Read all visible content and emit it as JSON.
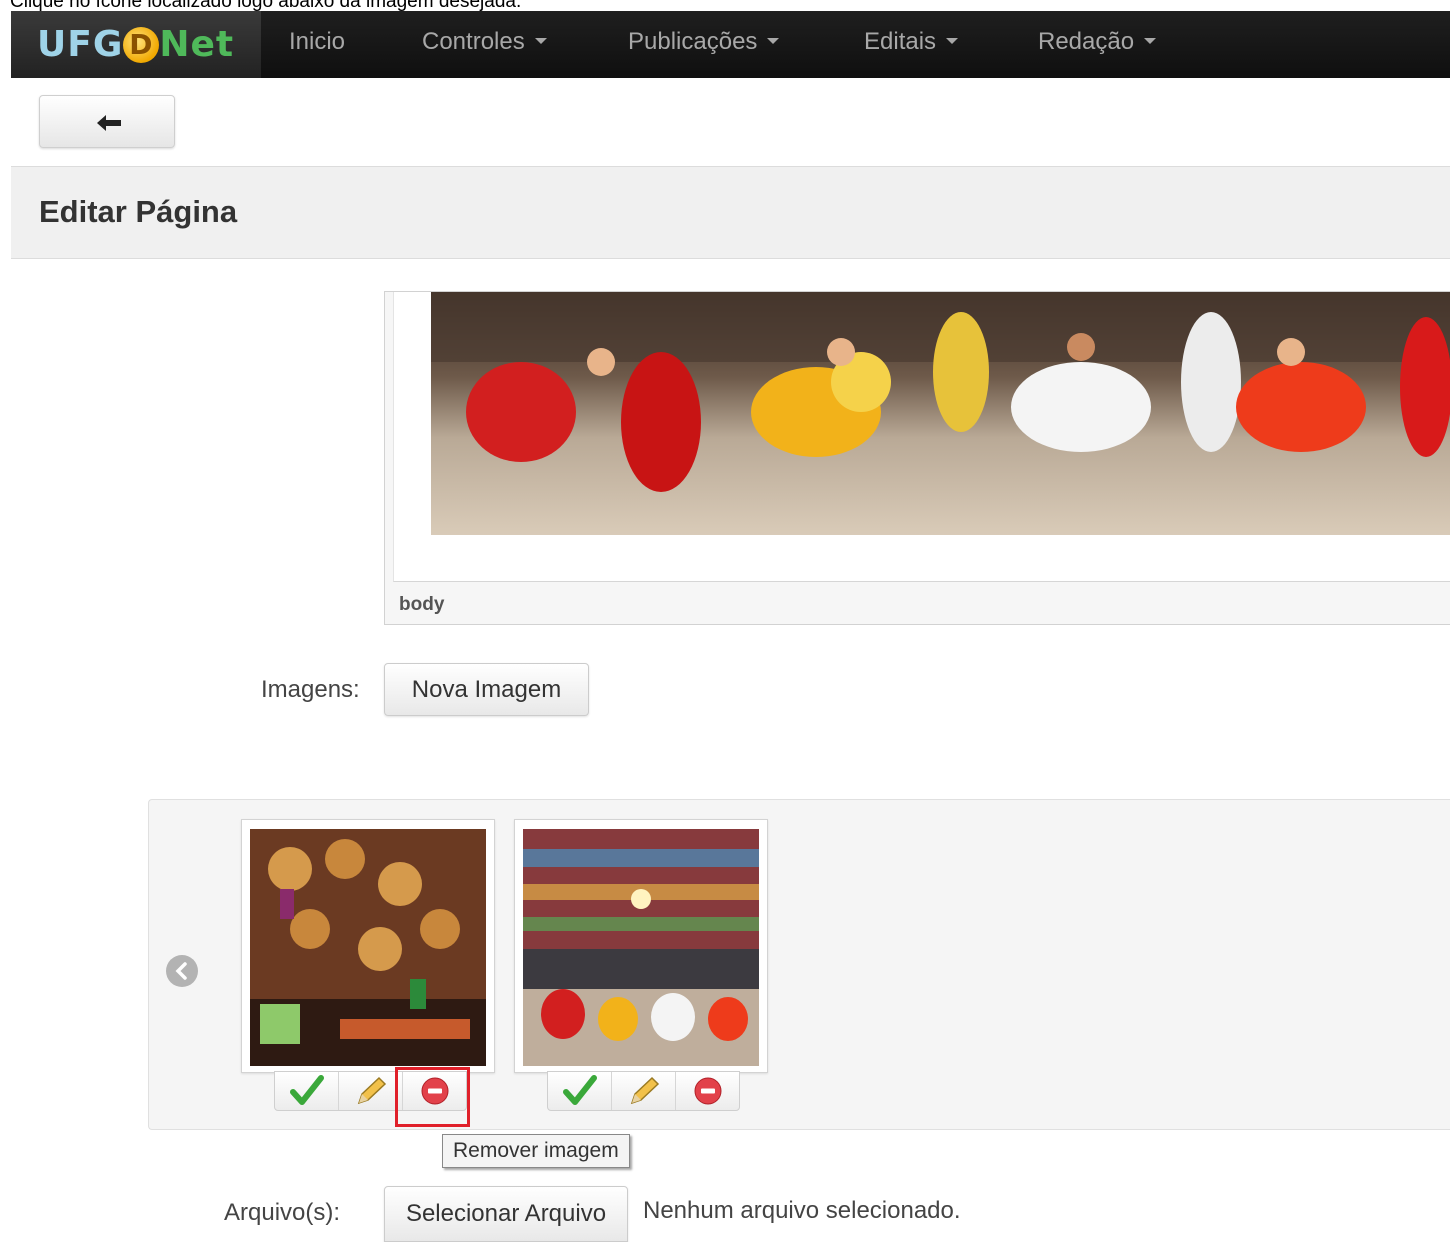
{
  "instruction": "Clique no ícone localizado logo abaixo da imagem desejada.",
  "navbar": {
    "brand": {
      "prefix": "UFG",
      "letter": "D",
      "suffix": "Net"
    },
    "items": [
      {
        "label": "Inicio",
        "has_caret": false
      },
      {
        "label": "Controles",
        "has_caret": true
      },
      {
        "label": "Publicações",
        "has_caret": true
      },
      {
        "label": "Editais",
        "has_caret": true
      },
      {
        "label": "Redação",
        "has_caret": true
      }
    ]
  },
  "page": {
    "title": "Editar Página"
  },
  "editor": {
    "element_path": "body"
  },
  "images": {
    "label": "Imagens:",
    "new_button": "Nova Imagem"
  },
  "gallery": {
    "tooltip": "Remover imagem"
  },
  "files": {
    "label": "Arquivo(s):",
    "select_button": "Selecionar Arquivo",
    "status": "Nenhum arquivo selecionado."
  },
  "colors": {
    "navbar": "#111111",
    "highlight": "#e0202a",
    "approve": "#3aa83a",
    "remove": "#e2414a"
  }
}
